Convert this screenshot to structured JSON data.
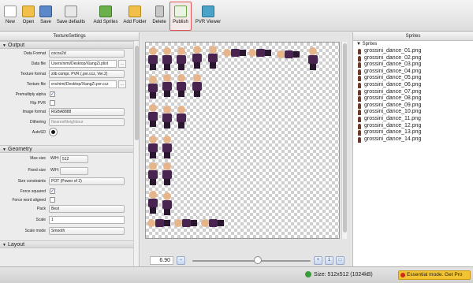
{
  "toolbar": {
    "buttons": [
      {
        "label": "New",
        "icon": "new-document-icon"
      },
      {
        "label": "Open",
        "icon": "folder-open-icon"
      },
      {
        "label": "Save",
        "icon": "floppy-disk-icon"
      },
      {
        "label": "Save defaults",
        "icon": "save-defaults-icon"
      },
      {
        "label": "Add Sprites",
        "icon": "add-sprites-icon"
      },
      {
        "label": "Add Folder",
        "icon": "add-folder-icon"
      },
      {
        "label": "Delete",
        "icon": "trash-icon"
      },
      {
        "label": "Publish",
        "icon": "publish-icon"
      },
      {
        "label": "PVR Viewer",
        "icon": "pvr-viewer-icon"
      }
    ]
  },
  "left_panel": {
    "title": "TextureSettings",
    "output": {
      "section": "Output",
      "data_format_label": "Data Format",
      "data_format_value": "cocos2d",
      "data_file_label": "Data file",
      "data_file_value": "Users/nimi/Desktop/XiangZi.plist",
      "texture_format_label": "Texture format",
      "texture_format_value": "zlib compr. PVR (.pvr.ccz, Ver.2)",
      "texture_file_label": "Texture file",
      "texture_file_value": "ers/nimi/Desktop/XiangZi.pvr.ccz",
      "premultiply_label": "Premultiply alpha",
      "flip_pvr_label": "Flip PVR",
      "image_format_label": "Image format",
      "image_format_value": "RGBA8888",
      "dithering_label": "Dithering",
      "dithering_value": "NearestNeighbour",
      "autosd_label": "AutoSD",
      "browse": "..."
    },
    "geometry": {
      "section": "Geometry",
      "max_size_label": "Max size",
      "max_size_w": "W/H:",
      "max_size_value": "512",
      "fixed_size_label": "Fixed size",
      "fixed_size_w": "W/H:",
      "size_constraints_label": "Size constraints",
      "size_constraints_value": "POT (Power of 2)",
      "force_squared_label": "Force squared",
      "force_word_aligned_label": "Force word aligned",
      "pack_label": "Pack",
      "pack_value": "Best",
      "scale_label": "Scale",
      "scale_value": "1",
      "scale_mode_label": "Scale mode",
      "scale_mode_value": "Smooth"
    },
    "layout_section": "Layout"
  },
  "center": {
    "zoom_value": "6.90",
    "zoom_slider_fraction": 0.55
  },
  "right_panel": {
    "title": "Sprites",
    "root": "Sprites",
    "items": [
      "grossini_dance_01.png",
      "grossini_dance_02.png",
      "grossini_dance_03.png",
      "grossini_dance_04.png",
      "grossini_dance_05.png",
      "grossini_dance_06.png",
      "grossini_dance_07.png",
      "grossini_dance_08.png",
      "grossini_dance_09.png",
      "grossini_dance_10.png",
      "grossini_dance_11.png",
      "grossini_dance_12.png",
      "grossini_dance_13.png",
      "grossini_dance_14.png"
    ]
  },
  "status": {
    "size": "Size: 512x512 (1024kB)",
    "pro": "Essential mode. Get Pro"
  },
  "colors": {
    "publish_highlight": "#e05555",
    "pro_badge": "#f1c232"
  }
}
